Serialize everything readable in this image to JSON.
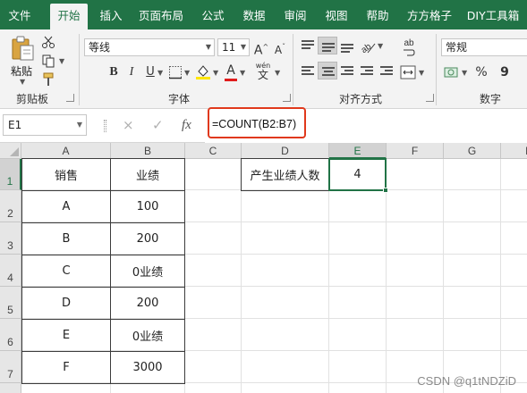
{
  "menu": {
    "items": [
      "文件",
      "开始",
      "插入",
      "页面布局",
      "公式",
      "数据",
      "审阅",
      "视图",
      "帮助",
      "方方格子",
      "DIY工具箱"
    ],
    "active": "开始"
  },
  "ribbon": {
    "clipboard": {
      "paste_label": "粘贴",
      "group_label": "剪贴板"
    },
    "font": {
      "font_name": "等线",
      "font_size": "11",
      "grow_label": "A",
      "shrink_label": "A",
      "bold": "B",
      "italic": "I",
      "underline": "U",
      "fill_color_label": "A",
      "wen_label": "wén",
      "wen_char": "文",
      "group_label": "字体"
    },
    "alignment": {
      "wrap_label": "ab",
      "group_label": "对齐方式"
    },
    "number": {
      "format": "常规",
      "percent": "%",
      "comma": "9",
      "group_label": "数字"
    }
  },
  "formula_bar": {
    "name_box": "E1",
    "cancel_icon": "×",
    "enter_icon": "✓",
    "fx_icon": "fx",
    "formula": "=COUNT(B2:B7)"
  },
  "grid": {
    "columns": [
      "A",
      "B",
      "C",
      "D",
      "E",
      "F",
      "G",
      "H"
    ],
    "rows": [
      "1",
      "2",
      "3",
      "4",
      "5",
      "6",
      "7"
    ],
    "active_cell": "E1",
    "table_header": {
      "a": "销售",
      "b": "业绩"
    },
    "table_rows": [
      {
        "a": "A",
        "b": "100"
      },
      {
        "a": "B",
        "b": "200"
      },
      {
        "a": "C",
        "b": "0业绩"
      },
      {
        "a": "D",
        "b": "200"
      },
      {
        "a": "E",
        "b": "0业绩"
      },
      {
        "a": "F",
        "b": "3000"
      }
    ],
    "d1": "产生业绩人数",
    "e1": "4"
  },
  "watermark": "CSDN @q1tNDZiD",
  "colors": {
    "accent": "#217346",
    "highlight": "#e0391c"
  }
}
